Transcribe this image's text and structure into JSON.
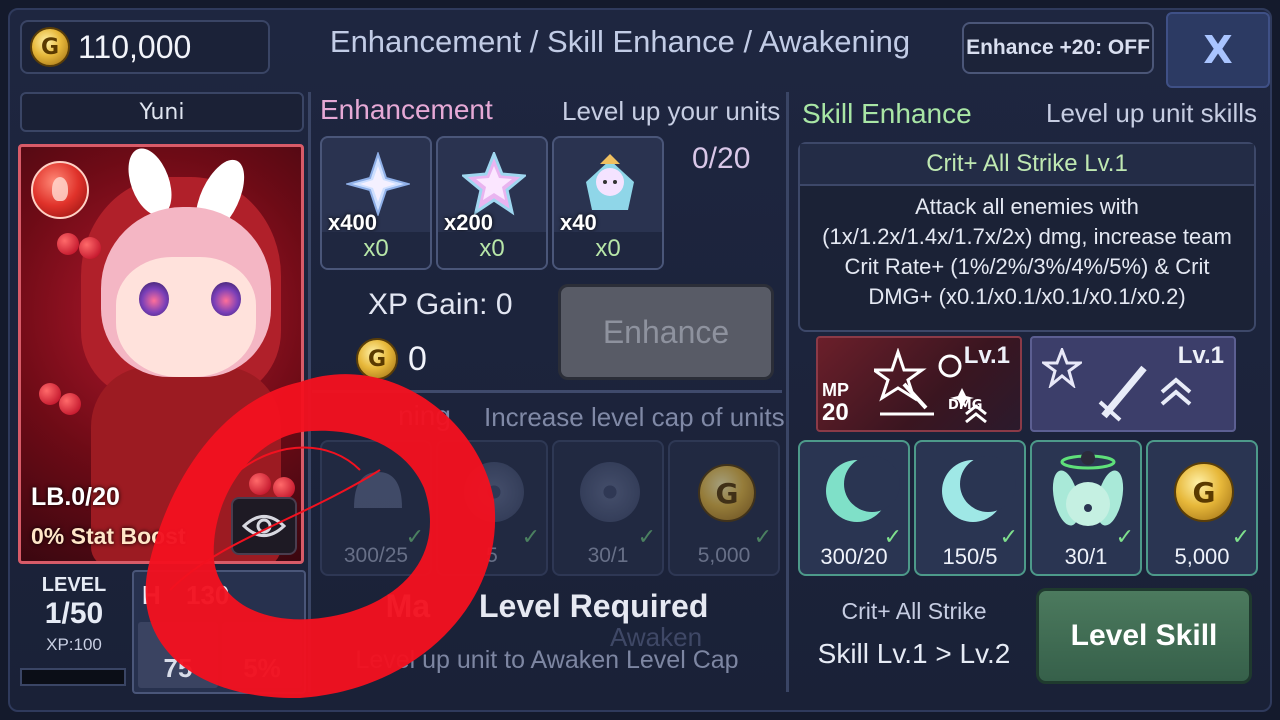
{
  "header": {
    "gold": "110,000",
    "coin_glyph": "G",
    "title": "Enhancement / Skill Enhance / Awakening",
    "toggle_label": "Enhance +20: OFF",
    "close_glyph": "X"
  },
  "unit": {
    "name": "Yuni",
    "limit_break": "LB.0/20",
    "stat_boost": "0% Stat Boost",
    "level_label": "LEVEL",
    "level_value": "1/50",
    "xp": "XP:100",
    "hp_label": "H",
    "hp_value": "130",
    "stat_a": "75",
    "stat_b": "5%"
  },
  "enhancement": {
    "title": "Enhancement",
    "subtitle": "Level up your units",
    "counter": "0/20",
    "materials": [
      {
        "qty": "x400",
        "count": "x0",
        "icon": "small-star-gem-icon"
      },
      {
        "qty": "x200",
        "count": "x0",
        "icon": "rainbow-star-icon"
      },
      {
        "qty": "x40",
        "count": "x0",
        "icon": "angel-doll-icon"
      }
    ],
    "xp_gain": "XP Gain: 0",
    "cost": "0",
    "button": "Enhance"
  },
  "awakening": {
    "title_visible": "ning",
    "subtitle": "Increase level cap of units",
    "requirements": [
      {
        "count": "300/25",
        "icon": "bell-icon"
      },
      {
        "count": "5",
        "icon": "disc-icon"
      },
      {
        "count": "30/1",
        "icon": "winged-disc-icon"
      },
      {
        "count": "5,000",
        "icon": "gold-coin-icon"
      }
    ],
    "required_title_a": "Ma",
    "required_title_b": "Level Required",
    "required_sub": "Level up unit to Awaken Level Cap",
    "ghost_button": "Awaken"
  },
  "skill": {
    "title": "Skill Enhance",
    "subtitle": "Level up unit skills",
    "card_title": "Crit+ All Strike Lv.1",
    "description": "Attack all enemies with (1x/1.2x/1.4x/1.7x/2x) dmg, increase team Crit Rate+ (1%/2%/3%/4%/5%) & Crit DMG+ (x0.1/x0.1/x0.1/x0.1/x0.2)",
    "icon_a_level": "Lv.1",
    "icon_a_mp_label": "MP",
    "icon_a_mp": "20",
    "icon_a_tag": "DMG",
    "icon_b_level": "Lv.1",
    "requirements": [
      {
        "count": "300/20",
        "icon": "crescent-moon-icon"
      },
      {
        "count": "150/5",
        "icon": "double-moon-icon"
      },
      {
        "count": "30/1",
        "icon": "bunny-orb-icon"
      },
      {
        "count": "5,000",
        "icon": "gold-coin-icon"
      }
    ],
    "skill_name": "Crit+ All Strike",
    "skill_change": "Skill Lv.1 > Lv.2",
    "button": "Level Skill"
  },
  "colors": {
    "background": "#1e2640",
    "enhance_title": "#e6a9d6",
    "skill_title": "#a9e6a5",
    "annotation": "#f2111f",
    "level_skill_button": "#4c7a5e"
  }
}
